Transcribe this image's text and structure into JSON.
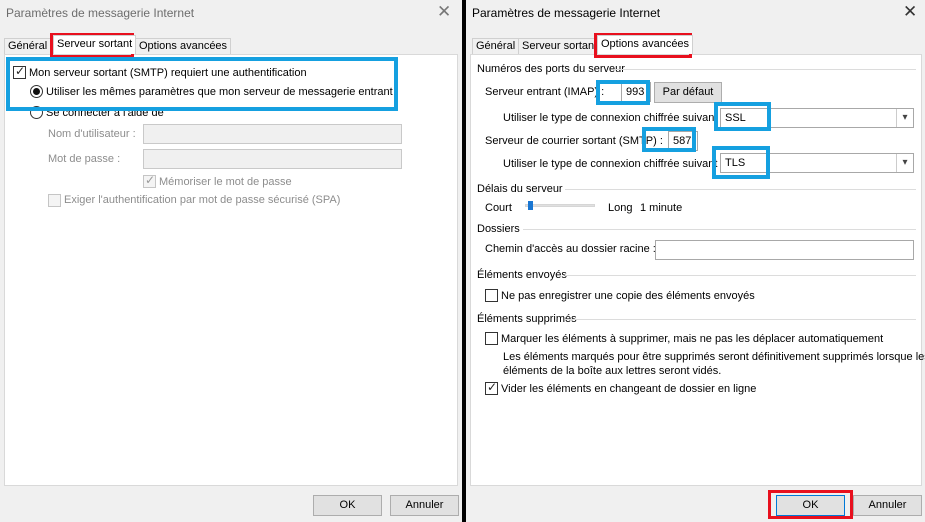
{
  "left_dialog": {
    "title": "Paramètres de messagerie Internet",
    "tabs": [
      "Général",
      "Serveur sortant",
      "Options avancées"
    ],
    "outgoing": {
      "smtp_auth_label": "Mon serveur sortant (SMTP) requiert une authentification",
      "same_settings_label": "Utiliser les mêmes paramètres que mon serveur de messagerie entrant",
      "connect_with_label": "Se connecter à l'aide de",
      "username_label": "Nom d'utilisateur :",
      "password_label": "Mot de passe :",
      "username_value": "",
      "password_value": "",
      "remember_password_label": "Mémoriser le mot de passe",
      "spa_label": "Exiger l'authentification par mot de passe sécurisé (SPA)"
    },
    "ok_label": "OK",
    "cancel_label": "Annuler"
  },
  "right_dialog": {
    "title": "Paramètres de messagerie Internet",
    "tabs": [
      "Général",
      "Serveur sortant",
      "Options avancées"
    ],
    "ports": {
      "section_title": "Numéros des ports du serveur",
      "incoming_label": "Serveur entrant (IMAP) :",
      "incoming_value": "993",
      "default_button": "Par défaut",
      "encryption_label_1": "Utiliser le type de connexion chiffrée suivant :",
      "encryption_value_1": "SSL",
      "outgoing_label": "Serveur de courrier sortant (SMTP) :",
      "outgoing_value": "587",
      "encryption_label_2": "Utiliser le type de connexion chiffrée suivant :",
      "encryption_value_2": "TLS"
    },
    "timeout": {
      "section_title": "Délais du serveur",
      "short_label": "Court",
      "long_label": "Long",
      "value": "1 minute",
      "level": 0.05
    },
    "folders": {
      "section_title": "Dossiers",
      "root_path_label": "Chemin d'accès au dossier racine :",
      "root_path_value": ""
    },
    "sent": {
      "section_title": "Éléments envoyés",
      "no_copy_label": "Ne pas enregistrer une copie des éléments envoyés"
    },
    "deleted": {
      "section_title": "Éléments supprimés",
      "mark_label": "Marquer les éléments à supprimer, mais ne pas les déplacer automatiquement",
      "note_line1": "Les éléments marqués pour être supprimés seront définitivement supprimés lorsque les",
      "note_line2": "éléments de la boîte aux lettres seront vidés.",
      "purge_label": "Vider les éléments en changeant de dossier en ligne"
    },
    "ok_label": "OK",
    "cancel_label": "Annuler"
  },
  "colors": {
    "highlight_red": "#e8101e",
    "highlight_blue": "#15a0e0"
  }
}
